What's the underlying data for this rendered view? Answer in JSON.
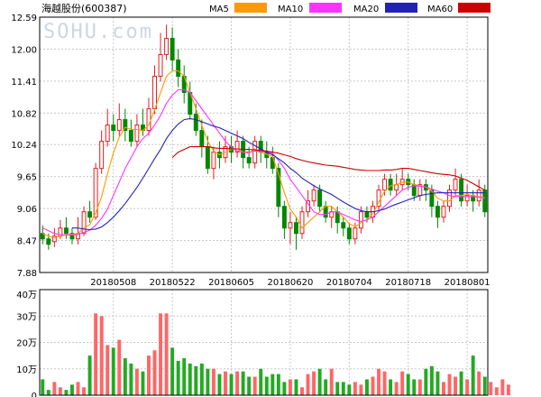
{
  "stock": {
    "title": "海越股份(600387)",
    "watermark": "SOHU.com"
  },
  "legend": [
    {
      "label": "MA5",
      "color": "#ff9900"
    },
    {
      "label": "MA10",
      "color": "#ff33ff"
    },
    {
      "label": "MA20",
      "color": "#2222bb"
    },
    {
      "label": "MA60",
      "color": "#cc0000"
    }
  ],
  "colors": {
    "up": "#e02020",
    "down": "#008800",
    "grid": "#c8c8c8",
    "axis": "#000000"
  },
  "chart_data": [
    {
      "type": "candlestick",
      "price_ticks": [
        "12.59",
        "12.00",
        "11.41",
        "10.82",
        "10.24",
        "9.65",
        "9.06",
        "8.47",
        "7.88"
      ],
      "ylim": [
        7.88,
        12.59
      ],
      "x_ticks": [
        {
          "label": "20180508",
          "index": 12
        },
        {
          "label": "20180522",
          "index": 22
        },
        {
          "label": "20180605",
          "index": 32
        },
        {
          "label": "20180620",
          "index": 42
        },
        {
          "label": "20180704",
          "index": 52
        },
        {
          "label": "20180718",
          "index": 62
        },
        {
          "label": "20180801",
          "index": 72
        }
      ],
      "candles": [
        [
          8.6,
          8.5,
          8.75,
          8.4
        ],
        [
          8.5,
          8.4,
          8.6,
          8.3
        ],
        [
          8.45,
          8.55,
          8.7,
          8.35
        ],
        [
          8.55,
          8.7,
          8.85,
          8.5
        ],
        [
          8.7,
          8.6,
          8.9,
          8.5
        ],
        [
          8.6,
          8.5,
          8.7,
          8.4
        ],
        [
          8.5,
          8.6,
          8.9,
          8.4
        ],
        [
          8.6,
          9.0,
          9.1,
          8.55
        ],
        [
          9.0,
          8.9,
          9.2,
          8.8
        ],
        [
          8.9,
          9.8,
          9.9,
          8.85
        ],
        [
          9.8,
          10.3,
          10.5,
          9.7
        ],
        [
          10.3,
          10.6,
          10.9,
          10.2
        ],
        [
          10.6,
          10.5,
          10.8,
          10.3
        ],
        [
          10.5,
          10.7,
          11.0,
          10.4
        ],
        [
          10.7,
          10.5,
          10.9,
          10.3
        ],
        [
          10.5,
          10.3,
          10.7,
          10.2
        ],
        [
          10.3,
          10.6,
          10.8,
          10.2
        ],
        [
          10.6,
          10.5,
          10.9,
          10.4
        ],
        [
          10.5,
          10.9,
          11.1,
          10.4
        ],
        [
          10.9,
          11.5,
          11.7,
          10.8
        ],
        [
          11.5,
          11.9,
          12.3,
          11.4
        ],
        [
          11.9,
          12.2,
          12.45,
          11.8
        ],
        [
          12.2,
          11.8,
          12.4,
          11.6
        ],
        [
          11.8,
          11.5,
          12.0,
          11.3
        ],
        [
          11.5,
          11.2,
          11.7,
          11.0
        ],
        [
          11.2,
          10.8,
          11.4,
          10.7
        ],
        [
          10.8,
          10.5,
          11.0,
          10.4
        ],
        [
          10.5,
          10.2,
          10.7,
          10.0
        ],
        [
          10.2,
          9.8,
          10.4,
          9.7
        ],
        [
          9.8,
          10.1,
          10.2,
          9.6
        ],
        [
          10.1,
          10.0,
          10.3,
          9.8
        ],
        [
          10.0,
          10.2,
          10.4,
          9.9
        ],
        [
          10.2,
          10.1,
          10.4,
          9.9
        ],
        [
          10.1,
          10.3,
          10.5,
          10.0
        ],
        [
          10.3,
          10.0,
          10.4,
          9.8
        ],
        [
          10.0,
          9.9,
          10.2,
          9.8
        ],
        [
          9.9,
          10.3,
          10.4,
          9.8
        ],
        [
          10.3,
          10.1,
          10.4,
          9.9
        ],
        [
          10.1,
          10.0,
          10.3,
          9.8
        ],
        [
          10.0,
          9.8,
          10.2,
          9.7
        ],
        [
          9.8,
          9.1,
          9.9,
          8.9
        ],
        [
          9.1,
          8.7,
          9.2,
          8.5
        ],
        [
          8.7,
          8.8,
          9.0,
          8.4
        ],
        [
          8.8,
          8.6,
          8.9,
          8.3
        ],
        [
          8.6,
          9.0,
          9.1,
          8.5
        ],
        [
          9.0,
          9.2,
          9.4,
          8.9
        ],
        [
          9.2,
          9.4,
          9.5,
          9.1
        ],
        [
          9.4,
          9.1,
          9.5,
          9.0
        ],
        [
          9.1,
          8.9,
          9.2,
          8.8
        ],
        [
          8.9,
          9.0,
          9.1,
          8.7
        ],
        [
          9.0,
          8.8,
          9.1,
          8.6
        ],
        [
          8.8,
          8.7,
          8.9,
          8.55
        ],
        [
          8.7,
          8.5,
          8.8,
          8.4
        ],
        [
          8.5,
          8.7,
          8.8,
          8.4
        ],
        [
          8.7,
          9.0,
          9.1,
          8.6
        ],
        [
          9.0,
          8.9,
          9.1,
          8.8
        ],
        [
          8.9,
          9.1,
          9.2,
          8.8
        ],
        [
          9.1,
          9.4,
          9.5,
          9.0
        ],
        [
          9.4,
          9.6,
          9.7,
          9.3
        ],
        [
          9.6,
          9.4,
          9.7,
          9.3
        ],
        [
          9.4,
          9.5,
          9.7,
          9.3
        ],
        [
          9.5,
          9.6,
          9.8,
          9.4
        ],
        [
          9.6,
          9.5,
          9.7,
          9.4
        ],
        [
          9.5,
          9.3,
          9.6,
          9.2
        ],
        [
          9.3,
          9.5,
          9.6,
          9.2
        ],
        [
          9.5,
          9.4,
          9.6,
          9.2
        ],
        [
          9.4,
          9.1,
          9.5,
          8.9
        ],
        [
          9.1,
          8.9,
          9.2,
          8.7
        ],
        [
          8.9,
          9.1,
          9.2,
          8.8
        ],
        [
          9.1,
          9.4,
          9.5,
          9.0
        ],
        [
          9.4,
          9.6,
          9.8,
          9.3
        ],
        [
          9.6,
          9.2,
          9.7,
          9.1
        ],
        [
          9.2,
          9.3,
          9.5,
          9.1
        ],
        [
          9.3,
          9.2,
          9.4,
          9.0
        ],
        [
          9.2,
          9.4,
          9.6,
          9.1
        ],
        [
          9.4,
          9.0,
          9.5,
          8.9
        ]
      ],
      "ma5": [
        8.6,
        8.55,
        8.52,
        8.55,
        8.58,
        8.58,
        8.6,
        8.7,
        8.76,
        8.98,
        9.28,
        9.7,
        10.08,
        10.38,
        10.56,
        10.52,
        10.52,
        10.5,
        10.6,
        10.88,
        11.2,
        11.5,
        11.6,
        11.6,
        11.5,
        11.2,
        10.9,
        10.6,
        10.3,
        10.12,
        10.05,
        10.1,
        10.15,
        10.16,
        10.1,
        10.08,
        10.16,
        10.1,
        10.06,
        10.02,
        9.7,
        9.35,
        9.05,
        8.9,
        8.7,
        8.8,
        8.9,
        9.0,
        9.1,
        9.1,
        9.0,
        8.9,
        8.78,
        8.72,
        8.8,
        8.86,
        8.96,
        9.18,
        9.38,
        9.48,
        9.5,
        9.55,
        9.55,
        9.5,
        9.48,
        9.46,
        9.38,
        9.25,
        9.2,
        9.2,
        9.3,
        9.3,
        9.32,
        9.3,
        9.28,
        9.25
      ],
      "ma10": [
        8.7,
        8.65,
        8.6,
        8.58,
        8.57,
        8.57,
        8.58,
        8.62,
        8.66,
        8.75,
        8.88,
        9.05,
        9.3,
        9.55,
        9.8,
        10.0,
        10.2,
        10.35,
        10.45,
        10.6,
        10.78,
        11.0,
        11.15,
        11.25,
        11.25,
        11.2,
        11.05,
        10.9,
        10.75,
        10.6,
        10.45,
        10.3,
        10.2,
        10.12,
        10.1,
        10.1,
        10.12,
        10.12,
        10.1,
        10.08,
        9.95,
        9.8,
        9.6,
        9.45,
        9.3,
        9.15,
        9.0,
        8.95,
        8.95,
        9.0,
        9.0,
        8.95,
        8.9,
        8.85,
        8.82,
        8.85,
        8.9,
        9.0,
        9.1,
        9.2,
        9.3,
        9.4,
        9.45,
        9.48,
        9.47,
        9.46,
        9.42,
        9.38,
        9.35,
        9.3,
        9.28,
        9.28,
        9.28,
        9.28,
        9.27,
        9.26
      ],
      "ma20": [
        null,
        null,
        null,
        null,
        null,
        8.7,
        8.7,
        8.68,
        8.67,
        8.68,
        8.72,
        8.8,
        8.9,
        9.02,
        9.15,
        9.3,
        9.45,
        9.62,
        9.8,
        9.98,
        10.15,
        10.35,
        10.5,
        10.62,
        10.7,
        10.72,
        10.7,
        10.66,
        10.62,
        10.58,
        10.55,
        10.5,
        10.45,
        10.4,
        10.35,
        10.28,
        10.22,
        10.16,
        10.1,
        10.05,
        9.98,
        9.9,
        9.8,
        9.72,
        9.62,
        9.55,
        9.48,
        9.42,
        9.37,
        9.32,
        9.25,
        9.18,
        9.12,
        9.06,
        9.02,
        9.0,
        9.0,
        9.02,
        9.05,
        9.1,
        9.14,
        9.18,
        9.22,
        9.26,
        9.3,
        9.32,
        9.34,
        9.35,
        9.35,
        9.35,
        9.35,
        9.35,
        9.35,
        9.35,
        9.35,
        9.35
      ],
      "ma60": [
        null,
        null,
        null,
        null,
        null,
        null,
        null,
        null,
        null,
        null,
        null,
        null,
        null,
        null,
        null,
        null,
        null,
        null,
        null,
        null,
        null,
        null,
        10.0,
        10.1,
        10.15,
        10.2,
        10.2,
        10.2,
        10.2,
        10.18,
        10.17,
        10.17,
        10.16,
        10.16,
        10.15,
        10.15,
        10.14,
        10.13,
        10.12,
        10.1,
        10.08,
        10.05,
        10.02,
        9.98,
        9.95,
        9.92,
        9.9,
        9.88,
        9.86,
        9.85,
        9.84,
        9.82,
        9.8,
        9.78,
        9.77,
        9.76,
        9.76,
        9.76,
        9.77,
        9.77,
        9.78,
        9.8,
        9.8,
        9.78,
        9.76,
        9.74,
        9.72,
        9.7,
        9.69,
        9.68,
        9.66,
        9.62,
        9.58,
        9.52,
        9.46,
        9.4
      ]
    },
    {
      "type": "bar",
      "title": "volume",
      "vol_ticks": [
        "40万",
        "30万",
        "20万",
        "10万",
        "0"
      ],
      "ylim": [
        0,
        40
      ],
      "values": [
        6,
        2,
        5,
        3,
        2,
        4,
        5,
        3,
        15,
        31,
        30,
        19,
        18,
        21,
        14,
        12,
        10,
        9,
        15,
        17,
        31,
        31,
        18,
        13,
        14,
        12,
        11,
        12,
        10,
        10,
        8,
        9,
        8,
        9,
        9,
        7,
        7,
        10,
        7,
        8,
        8,
        5,
        6,
        6,
        3,
        8,
        9,
        10,
        6,
        10,
        5,
        5,
        4,
        5,
        4,
        6,
        7,
        10,
        9,
        6,
        5,
        9,
        8,
        6,
        6,
        10,
        11,
        9,
        5,
        8,
        7,
        9,
        6,
        15,
        9,
        7,
        5,
        3,
        6,
        4
      ]
    }
  ]
}
